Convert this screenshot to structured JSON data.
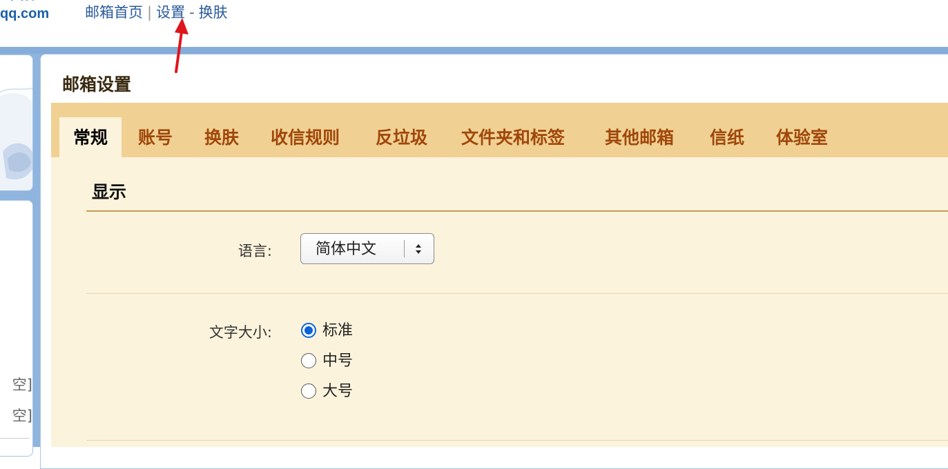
{
  "header": {
    "logo_text": "邮箱",
    "logo_domain": "qq.com",
    "nav": {
      "home": "邮箱首页",
      "separator": "|",
      "settings": "设置",
      "dash": "-",
      "skin": "换肤"
    }
  },
  "sidebar": {
    "rows": [
      "空]",
      "空]"
    ]
  },
  "main": {
    "title": "邮箱设置",
    "tabs": [
      {
        "label": "常规",
        "active": true
      },
      {
        "label": "账号",
        "active": false
      },
      {
        "label": "换肤",
        "active": false
      },
      {
        "label": "收信规则",
        "active": false
      },
      {
        "label": "反垃圾",
        "active": false
      },
      {
        "label": "文件夹和标签",
        "active": false
      },
      {
        "label": "其他邮箱",
        "active": false
      },
      {
        "label": "信纸",
        "active": false
      },
      {
        "label": "体验室",
        "active": false
      }
    ],
    "section": {
      "title": "显示",
      "language": {
        "label": "语言:",
        "selected": "简体中文"
      },
      "font_size": {
        "label": "文字大小:",
        "options": [
          {
            "label": "标准",
            "checked": true
          },
          {
            "label": "中号",
            "checked": false
          },
          {
            "label": "大号",
            "checked": false
          }
        ]
      }
    }
  },
  "colors": {
    "tab_bar": "#f0d193",
    "content_bg": "#fcf3dc",
    "tab_text": "#a0470b",
    "nav_link": "#2a5a9a",
    "accent_blue": "#0a64d8",
    "band_blue": "#8fb4de",
    "annotation_arrow": "#e0141b"
  },
  "icons": {
    "annotation": "red-arrow-icon",
    "select_caret": "updown-caret-icon"
  }
}
